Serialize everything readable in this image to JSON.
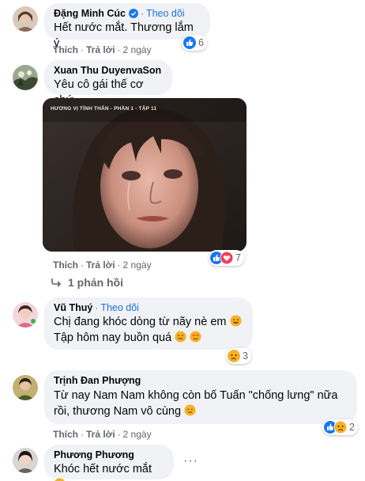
{
  "comments": [
    {
      "name": "Đặng Minh Cúc",
      "follow": "Theo dõi",
      "text": "Hết nước mắt. Thương lắm ý",
      "like": "Thích",
      "reply": "Trả lời",
      "time": "2 ngày",
      "reactions": "6"
    },
    {
      "name": "Xuan Thu DuyenvaSon",
      "text": "Yêu cô gái thế cơ chứ",
      "image_caption": "HƯƠNG VỊ TÌNH THÂN - PHẦN 1 - TẬP 11",
      "like": "Thích",
      "reply": "Trả lời",
      "time": "2 ngày",
      "reactions": "7",
      "replies_link": "1 phản hồi"
    },
    {
      "name": "Vũ Thuý",
      "follow": "Theo dõi",
      "text_line1": "Chị đang khóc dòng từ nãy nè em",
      "text_line2": "Tập hôm nay buồn quá",
      "like": "Thích",
      "reply": "Trả lời",
      "time": "2 ngày",
      "reactions": "3"
    },
    {
      "name": "Trịnh Đan Phượng",
      "text_line1": "Từ nay Nam Nam không còn bố Tuấn \"chống lưng\" nữa",
      "text_line2": "rồi, thương Nam vô cùng",
      "like": "Thích",
      "reply": "Trả lời",
      "time": "2 ngày",
      "reactions": "2"
    },
    {
      "name": "Phương Phương",
      "text": "Khóc hết nước mắt"
    }
  ],
  "colors": {
    "bubble": "#f0f2f5",
    "link": "#216fdb",
    "meta": "#65676b",
    "like_blue": "#1877f2",
    "love_red": "#f33e58",
    "sad_yellow": "#f7b125"
  }
}
